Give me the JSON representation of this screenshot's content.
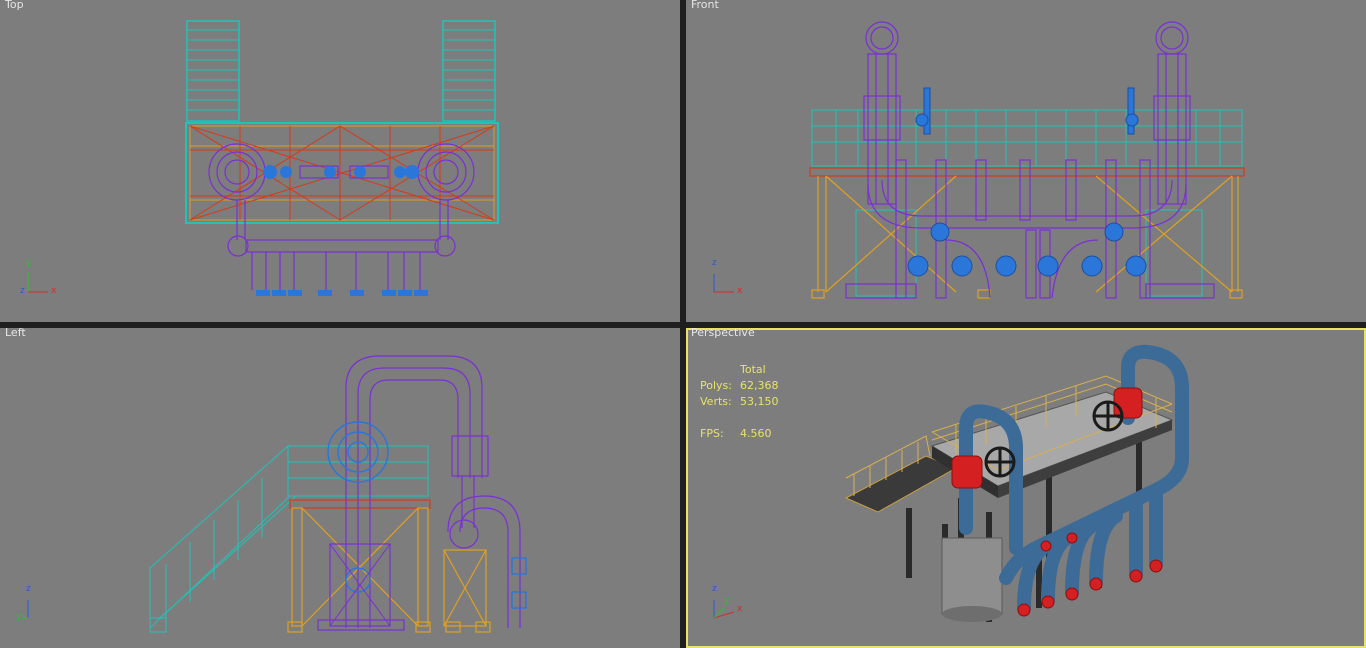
{
  "colors": {
    "viewport_bg": "#7d7d7d",
    "active_border": "#e8e26a",
    "label_text": "#e6e6e6",
    "stats_text": "#e8e26a",
    "wire_purple": "#7a2fd6",
    "wire_teal": "#1fc3b8",
    "wire_blue": "#2b76d9",
    "wire_orange": "#e0a020",
    "wire_red": "#d63a1a",
    "axis_x": "#d62a2a",
    "axis_y": "#2ac42a",
    "axis_z": "#2a5ad6"
  },
  "viewports": {
    "top": {
      "label": "Top",
      "axis": [
        "y",
        "z",
        "x"
      ]
    },
    "front": {
      "label": "Front",
      "axis": [
        "z",
        "x"
      ]
    },
    "left": {
      "label": "Left",
      "axis": [
        "z",
        "y"
      ]
    },
    "perspective": {
      "label": "Perspective",
      "axis": [
        "z",
        "y",
        "x"
      ],
      "stats": {
        "header": "Total",
        "polys_label": "Polys:",
        "polys_value": "62,368",
        "verts_label": "Verts:",
        "verts_value": "53,150",
        "fps_label": "FPS:",
        "fps_value": "4.560"
      }
    }
  }
}
